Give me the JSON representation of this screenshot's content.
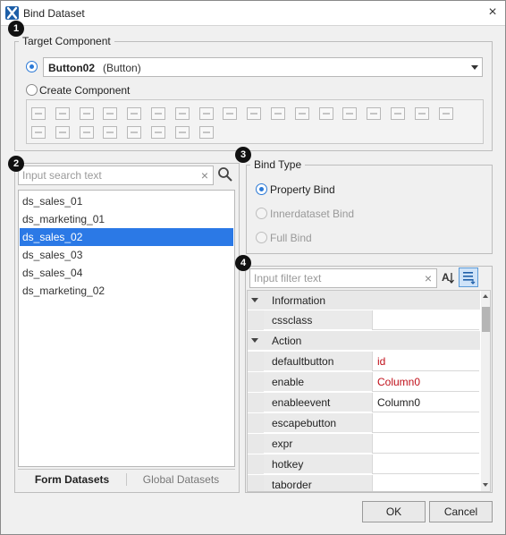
{
  "window": {
    "title": "Bind Dataset",
    "close_glyph": "×"
  },
  "badges": [
    "1",
    "2",
    "3",
    "4"
  ],
  "target_component": {
    "legend": "Target Component",
    "selected_name": "Button02",
    "selected_type": "(Button)",
    "create_label": "Create Component",
    "palette_icons": [
      "button-icon",
      "combo-icon",
      "edit-icon",
      "spin-icon",
      "static-icon",
      "textarea-icon",
      "grid-icon",
      "cursor-icon",
      "radio-icon",
      "checkbox-icon",
      "listbox-icon",
      "table-icon",
      "progressbar-icon",
      "menu-icon",
      "treeview-icon",
      "div-icon",
      "tab-icon",
      "calendar-icon",
      "imageviewer-icon",
      "maskedit-icon",
      "plugin-icon",
      "listview-icon",
      "sketch-icon",
      "dotted-grid-icon",
      "download-icon",
      "upload-icon"
    ]
  },
  "datasets": {
    "search_placeholder": "Input search text",
    "items": [
      "ds_sales_01",
      "ds_marketing_01",
      "ds_sales_02",
      "ds_sales_03",
      "ds_sales_04",
      "ds_marketing_02"
    ],
    "selected_index": 2,
    "tabs": [
      "Form Datasets",
      "Global Datasets"
    ]
  },
  "bind_type": {
    "legend": "Bind Type",
    "options": [
      "Property Bind",
      "Innerdataset Bind",
      "Full Bind"
    ]
  },
  "properties": {
    "filter_placeholder": "Input filter text",
    "rows": [
      {
        "kind": "category",
        "label": "Information"
      },
      {
        "kind": "prop",
        "name": "cssclass",
        "value": ""
      },
      {
        "kind": "category",
        "label": "Action"
      },
      {
        "kind": "prop",
        "name": "defaultbutton",
        "value": "id",
        "color": "#c0101a"
      },
      {
        "kind": "prop",
        "name": "enable",
        "value": "Column0",
        "color": "#c0101a"
      },
      {
        "kind": "prop",
        "name": "enableevent",
        "value": "Column0",
        "color": "#222222"
      },
      {
        "kind": "prop",
        "name": "escapebutton",
        "value": ""
      },
      {
        "kind": "prop",
        "name": "expr",
        "value": ""
      },
      {
        "kind": "prop",
        "name": "hotkey",
        "value": ""
      },
      {
        "kind": "prop",
        "name": "taborder",
        "value": ""
      }
    ]
  },
  "footer": {
    "ok": "OK",
    "cancel": "Cancel"
  },
  "colors": {
    "selection": "#2b79e6",
    "accent_radio": "#2b79d6",
    "bound_value": "#c0101a"
  }
}
